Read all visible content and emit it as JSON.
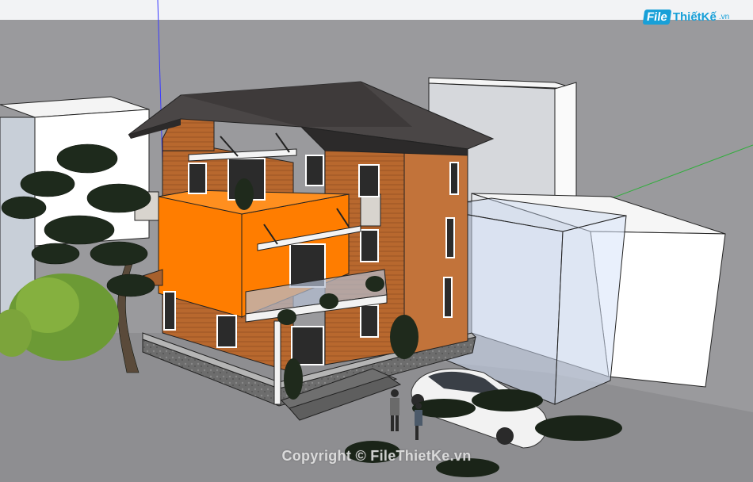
{
  "logo": {
    "file_text": "File",
    "brand_text": "ThiếtKế",
    "tld_text": ".vn"
  },
  "watermark": {
    "text": "Copyright © FileThietKe.vn"
  },
  "colors": {
    "sky": "#ecedef",
    "ground": "#8f8f92",
    "roof": "#4a4646",
    "wood": "#b8682e",
    "accent_orange": "#ff7d00",
    "axis_blue": "#3a3aff",
    "axis_green": "#2fae3a",
    "brand_blue": "#18a0d8"
  },
  "scene": {
    "description_icons": [
      "house-model",
      "car-model",
      "tree-model",
      "person-model"
    ]
  }
}
